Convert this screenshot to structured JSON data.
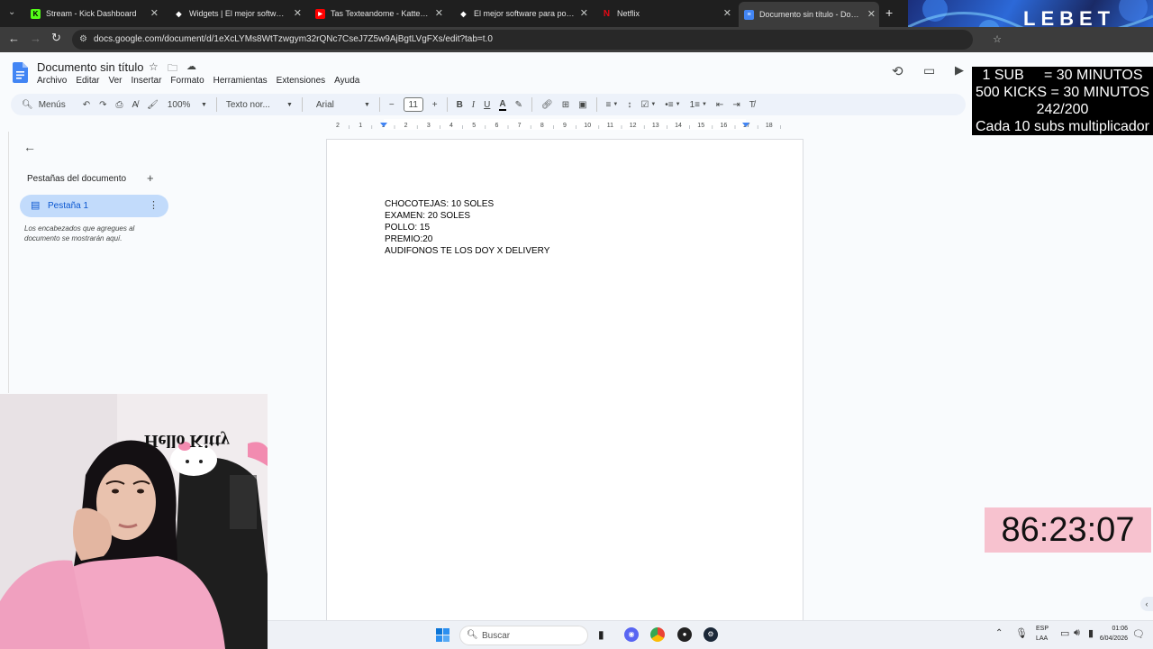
{
  "browser": {
    "tabs": [
      {
        "title": "Stream - Kick Dashboard",
        "icon": "kick-icon",
        "color": "#53fc18"
      },
      {
        "title": "Widgets | El mejor software par",
        "icon": "streamelements-icon",
        "color": "#ffffff"
      },
      {
        "title": "Tas Texteandome - Katteyes x I",
        "icon": "youtube-icon",
        "color": "#ff0000"
      },
      {
        "title": "El mejor software para potencia",
        "icon": "streamelements-icon",
        "color": "#ffffff"
      },
      {
        "title": "Netflix",
        "icon": "netflix-icon",
        "color": "#e50914"
      },
      {
        "title": "Documento sin título - Docume",
        "icon": "docs-icon",
        "color": "#4285f4"
      }
    ],
    "url": "docs.google.com/document/d/1eXcLYMs8WtTzwgym32rQNc7CseJ7Z5w9AjBgtLVgFXs/edit?tab=t.0"
  },
  "docs": {
    "title": "Documento sin título",
    "menu": [
      "Archivo",
      "Editar",
      "Ver",
      "Insertar",
      "Formato",
      "Herramientas",
      "Extensiones",
      "Ayuda"
    ],
    "toolbar": {
      "search_label": "Menús",
      "zoom": "100%",
      "style": "Texto nor...",
      "font": "Arial",
      "font_size": "11"
    },
    "ruler_labels": [
      "2",
      "1",
      "1",
      "2",
      "3",
      "4",
      "5",
      "6",
      "7",
      "8",
      "9",
      "10",
      "11",
      "12",
      "13",
      "14",
      "15",
      "16",
      "17",
      "18"
    ],
    "sidebar": {
      "heading": "Pestañas del documento",
      "tab_label": "Pestaña 1",
      "hint": "Los encabezados que agregues al documento se mostrarán aquí."
    },
    "content_lines": [
      "CHOCOTEJAS: 10 SOLES",
      "EXAMEN: 20 SOLES",
      "POLLO: 15",
      "PREMIO:20",
      "AUDIFONOS TE LOS DOY X DELIVERY"
    ]
  },
  "overlay": {
    "lebet_logo": "LEBET",
    "subs_lines": [
      "1 SUB     = 30 MINUTOS",
      "500 KICKS = 30 MINUTOS",
      "242/200",
      "Cada 10 subs multiplicador"
    ],
    "timer": "86:23:07"
  },
  "webcam": {
    "poster_text": "Hello Kitty"
  },
  "taskbar": {
    "search_label": "Buscar",
    "lang_top": "ESP",
    "lang_bottom": "LAA",
    "time": "01:06",
    "date": "6/04/2026"
  },
  "colors": {
    "chrome_dark": "#1f1f1f",
    "docs_blue": "#4285f4",
    "tab_selected_bg": "#c2dbfb",
    "timer_bg": "#f7c2cf"
  }
}
